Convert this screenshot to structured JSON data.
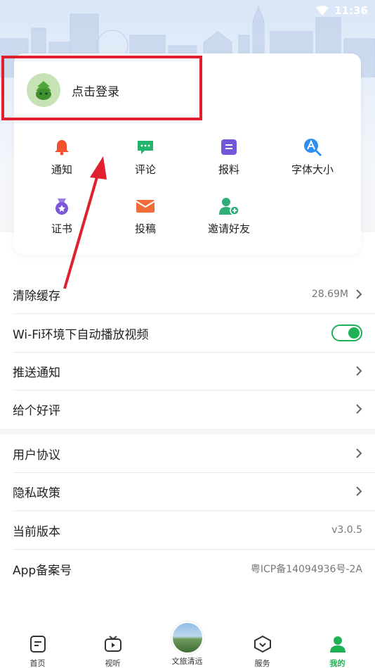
{
  "status": {
    "time": "11:36"
  },
  "login": {
    "label": "点击登录"
  },
  "grid": [
    {
      "label": "通知",
      "icon": "bell-icon",
      "color": "#f3522f"
    },
    {
      "label": "评论",
      "icon": "comment-icon",
      "color": "#23b46c"
    },
    {
      "label": "报料",
      "icon": "report-icon",
      "color": "#7357d8"
    },
    {
      "label": "字体大小",
      "icon": "font-size-icon",
      "color": "#2f8ff0"
    },
    {
      "label": "证书",
      "icon": "medal-icon",
      "color": "#7b57d8"
    },
    {
      "label": "投稿",
      "icon": "envelope-icon",
      "color": "#f26b3a"
    },
    {
      "label": "邀请好友",
      "icon": "add-friend-icon",
      "color": "#2fae77"
    }
  ],
  "settings": [
    {
      "label": "清除缓存",
      "value": "28.69M"
    },
    {
      "label": "Wi-Fi环境下自动播放视频",
      "toggle": true
    },
    {
      "label": "推送通知"
    },
    {
      "label": "给个好评"
    }
  ],
  "info": [
    {
      "label": "用户协议"
    },
    {
      "label": "隐私政策"
    },
    {
      "label": "当前版本",
      "value": "v3.0.5"
    },
    {
      "label": "App备案号",
      "value": "粤ICP备14094936号-2A"
    }
  ],
  "tabs": [
    {
      "label": "首页",
      "icon": "home-doc-icon"
    },
    {
      "label": "视听",
      "icon": "tv-play-icon"
    },
    {
      "label": "文旅清远",
      "icon": "scenery-photo-icon"
    },
    {
      "label": "服务",
      "icon": "service-shield-icon"
    },
    {
      "label": "我的",
      "icon": "profile-icon",
      "active": true
    }
  ],
  "colors": {
    "accent": "#1fb154",
    "annotation": "#e0202e"
  }
}
